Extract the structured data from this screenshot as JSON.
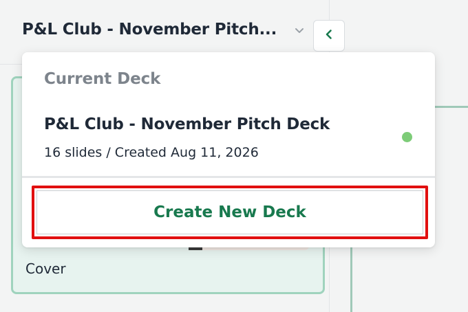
{
  "header": {
    "deck_title": "P&L Club - November Pitch...",
    "chevron_icon": "chevron-down-icon",
    "collapse_icon": "chevron-left-icon"
  },
  "slides": [
    {
      "label": "Cover"
    }
  ],
  "dropdown": {
    "section_label": "Current Deck",
    "current_deck": {
      "title": "P&L Club - November Pitch Deck",
      "meta": "16 slides / Created Aug 11, 2026",
      "status_color": "#7dcc78"
    },
    "create_button_label": "Create New Deck"
  },
  "colors": {
    "accent_green": "#18794e",
    "highlight_red": "#e10f0f",
    "selected_card_border": "#9fd3bd"
  }
}
